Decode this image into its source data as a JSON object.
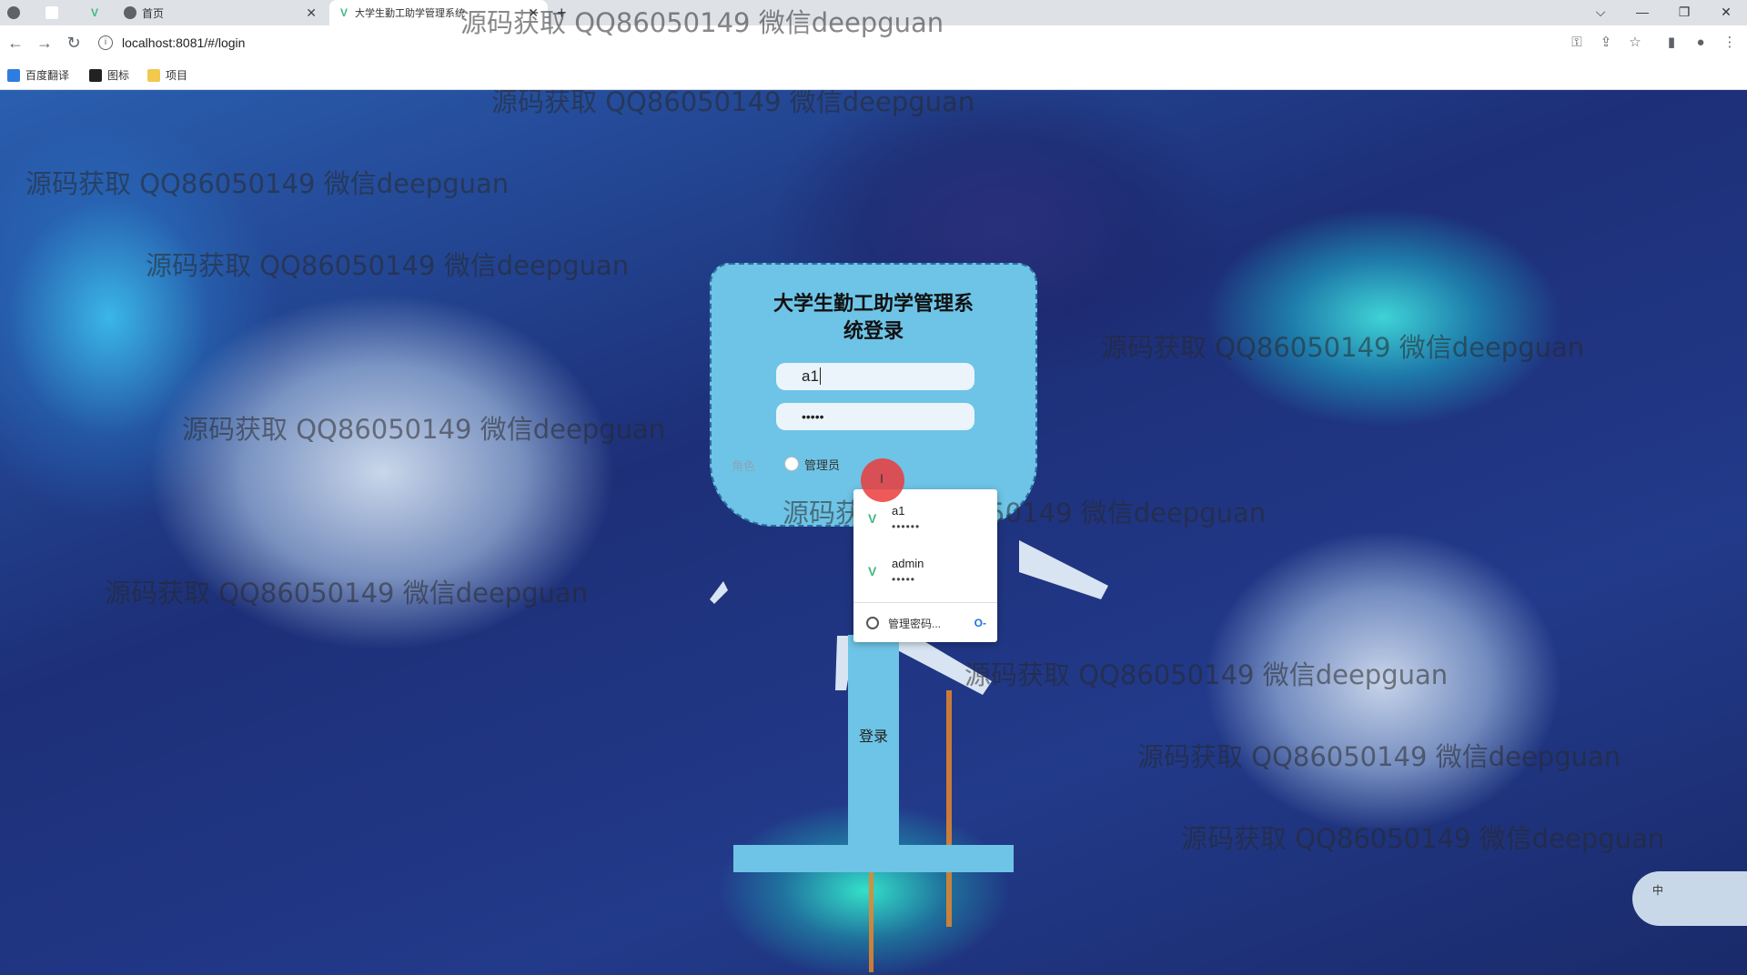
{
  "browser": {
    "tabs": [
      {
        "label": "首页"
      },
      {
        "label": "大学生勤工助学管理系统"
      }
    ],
    "new_tab": "+",
    "url": "localhost:8081/#/login",
    "bookmarks": [
      "百度翻译",
      "图标",
      "项目"
    ],
    "window_controls": [
      "⌵",
      "—",
      "❐",
      "✕"
    ]
  },
  "watermark_text": "源码获取 QQ86050149 微信deepguan",
  "login": {
    "title_line1": "大学生勤工助学管理系",
    "title_line2": "统登录",
    "username_value": "a1",
    "password_value": "•••••",
    "role_label": "角色",
    "role_option": "管理员",
    "login_button": "登录"
  },
  "autofill": {
    "entries": [
      {
        "username": "a1",
        "password_mask": "••••••"
      },
      {
        "username": "admin",
        "password_mask": "•••••"
      }
    ],
    "manage_label": "管理密码...",
    "key_icon": "key-icon"
  },
  "ime": {
    "label": "中"
  },
  "colors": {
    "panel": "#6ec4e6",
    "vue_green": "#41b883"
  }
}
